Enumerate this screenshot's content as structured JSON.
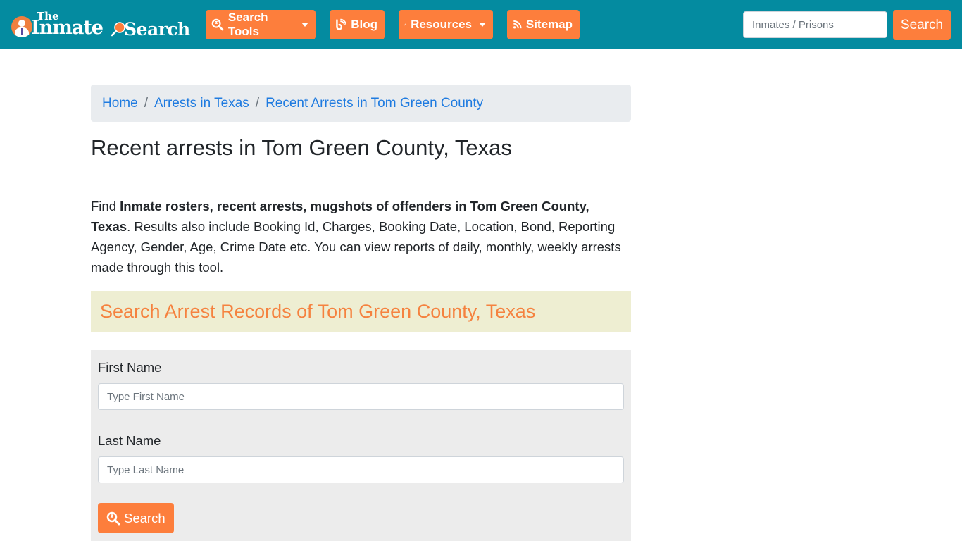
{
  "header": {
    "logo": {
      "the": "The",
      "inmate": "Inmate",
      "search": "Search"
    },
    "nav": [
      {
        "label": "Search Tools",
        "icon": "search-tools-icon",
        "dropdown": true
      },
      {
        "label": "Blog",
        "icon": "blog-icon",
        "dropdown": false
      },
      {
        "label": "Resources",
        "icon": "leaf-icon",
        "dropdown": true
      },
      {
        "label": "Sitemap",
        "icon": "rss-icon",
        "dropdown": false
      }
    ],
    "search": {
      "placeholder": "Inmates / Prisons",
      "value": "",
      "button_label": "Search"
    }
  },
  "breadcrumb": [
    {
      "label": "Home"
    },
    {
      "label": "Arrests in Texas"
    },
    {
      "label": "Recent Arrests in Tom Green County"
    }
  ],
  "breadcrumb_separator": "/",
  "page_title": "Recent arrests in Tom Green County, Texas",
  "intro": {
    "prefix": "Find ",
    "bold": "Inmate rosters, recent arrests, mugshots of offenders in Tom Green County, Texas",
    "suffix": ". Results also include Booking Id, Charges, Booking Date, Location, Bond, Reporting Agency, Gender, Age, Crime Date etc. You can view reports of daily, monthly, weekly arrests made through this tool."
  },
  "section_heading": "Search Arrest Records of Tom Green County, Texas",
  "form": {
    "first_name": {
      "label": "First Name",
      "placeholder": "Type First Name",
      "value": ""
    },
    "last_name": {
      "label": "Last Name",
      "placeholder": "Type Last Name",
      "value": ""
    },
    "submit_label": "Search"
  },
  "colors": {
    "navbar": "#048ba0",
    "accent": "#fd7e3c",
    "link": "#1f7be0",
    "banner_bg": "#eeeed2",
    "banner_text": "#f5823f",
    "form_bg": "#ececec"
  }
}
